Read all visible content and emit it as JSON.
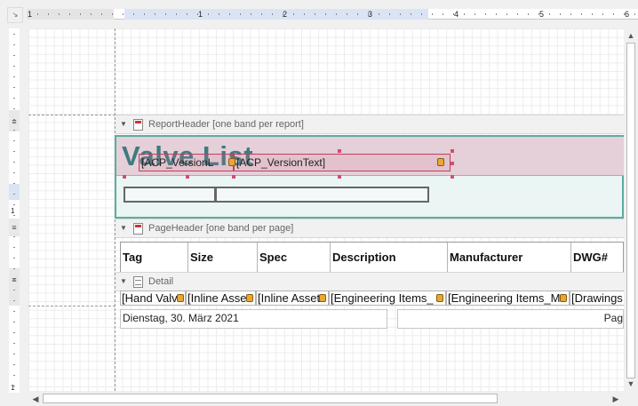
{
  "ruler": {
    "corner_icon": "ruler-corner-icon",
    "h_numbers": [
      "1",
      "1",
      "2",
      "3",
      "4",
      "5",
      "6"
    ],
    "v_numbers": [
      "1",
      "1"
    ],
    "v_bandmarks": [
      "≡",
      "≡",
      "≡"
    ]
  },
  "bands": {
    "report_header": {
      "label": "ReportHeader [one band per report]"
    },
    "page_header": {
      "label": "PageHeader [one band per page]"
    },
    "detail": {
      "label": "Detail"
    }
  },
  "report_header": {
    "title": "Valve List",
    "field_version": "[ACP_VersionL",
    "field_version_text": "[ACP_VersionText]"
  },
  "page_header": {
    "columns": [
      "Tag",
      "Size",
      "Spec",
      "Description",
      "Manufacturer",
      "DWG#"
    ]
  },
  "detail": {
    "cells": [
      "[Hand Valv",
      "[Inline Asse",
      "[Inline Asset",
      "[Engineering Items_",
      "[Engineering Items_M",
      "[Drawings"
    ]
  },
  "page_footer": {
    "date": "Dienstag, 30. März 2021",
    "page": "Pag"
  },
  "colors": {
    "report_header_border": "#5bada0",
    "report_header_fill": "#e5cfd8",
    "title_color": "#3e7b80",
    "selection_handle": "#d24e70"
  }
}
